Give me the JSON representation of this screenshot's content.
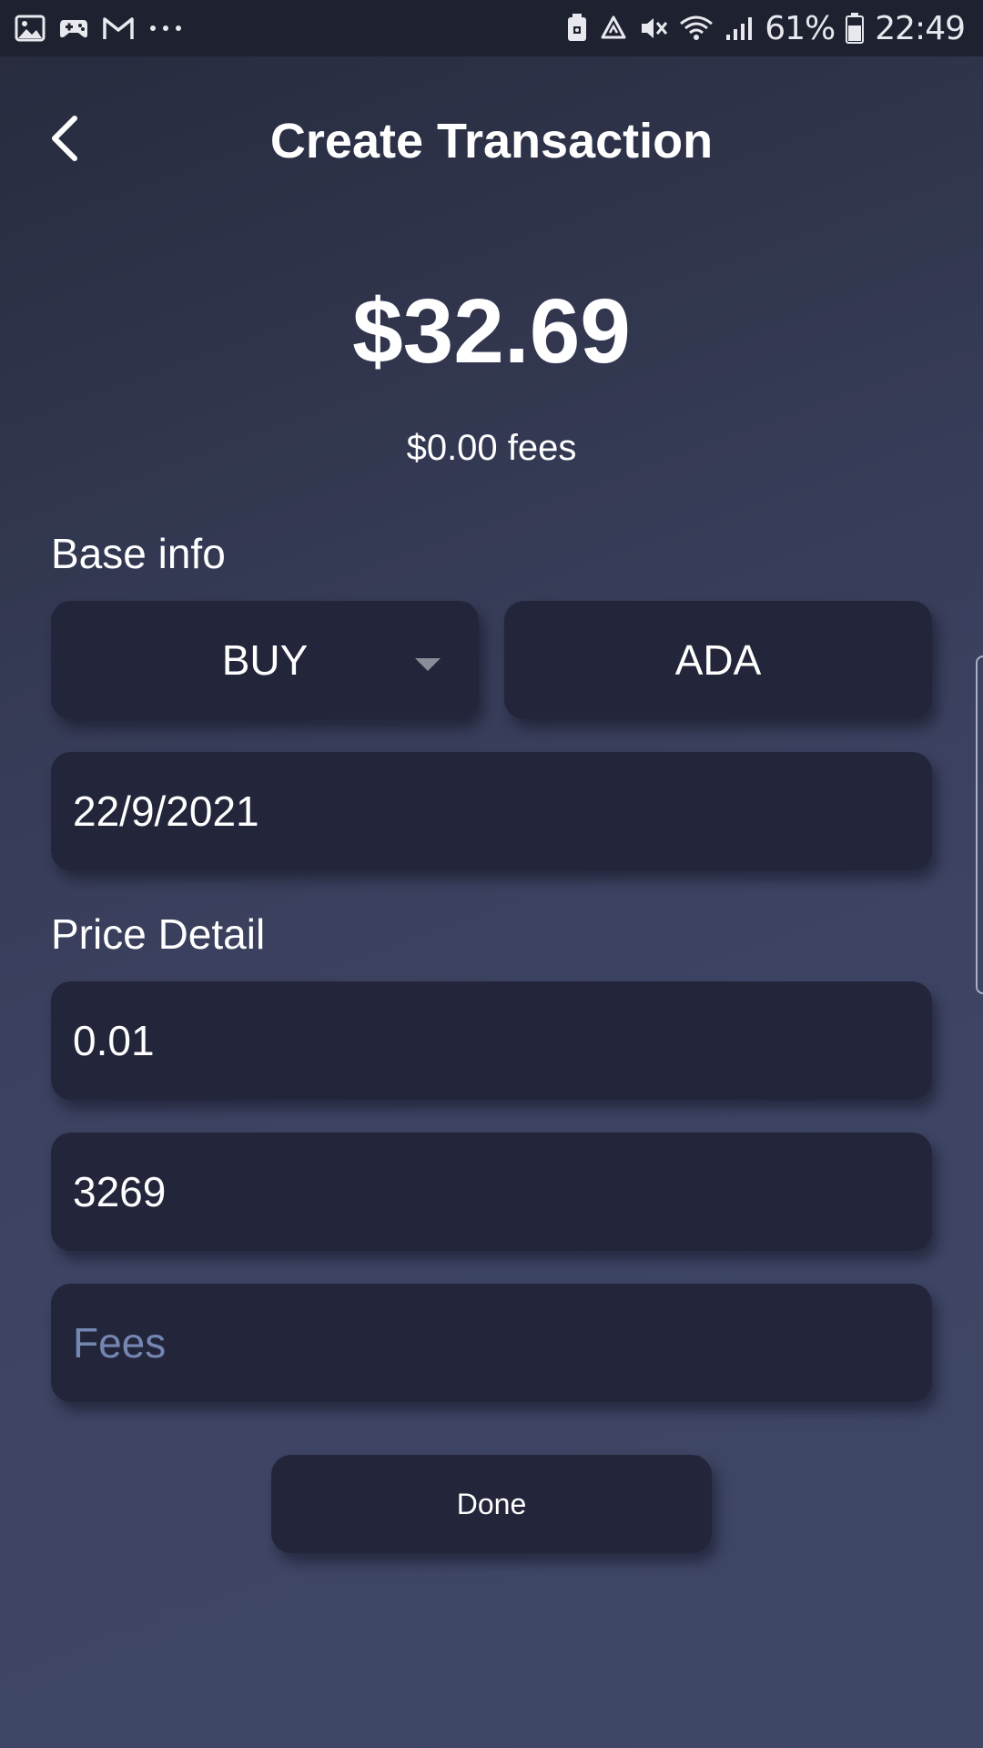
{
  "status_bar": {
    "battery_percent": "61%",
    "time": "22:49",
    "left_icons": [
      "gallery-icon",
      "game-controller-icon",
      "gmail-icon",
      "more-dots-icon"
    ],
    "right_icons": [
      "android-debug-icon",
      "recycle-icon",
      "mute-icon",
      "wifi-icon",
      "signal-icon",
      "battery-icon"
    ]
  },
  "header": {
    "title": "Create Transaction",
    "back_icon": "chevron-left-icon"
  },
  "summary": {
    "amount": "$32.69",
    "fees": "$0.00 fees"
  },
  "base_info": {
    "label": "Base info",
    "type_select": "BUY",
    "coin": "ADA",
    "date": "22/9/2021"
  },
  "price_detail": {
    "label": "Price Detail",
    "price": "0.01",
    "quantity": "3269",
    "fees_placeholder": "Fees"
  },
  "actions": {
    "done_label": "Done"
  },
  "colors": {
    "background": "#363b56",
    "field": "#23253a",
    "placeholder": "#7486b2",
    "status_bar": "#1e2130"
  }
}
